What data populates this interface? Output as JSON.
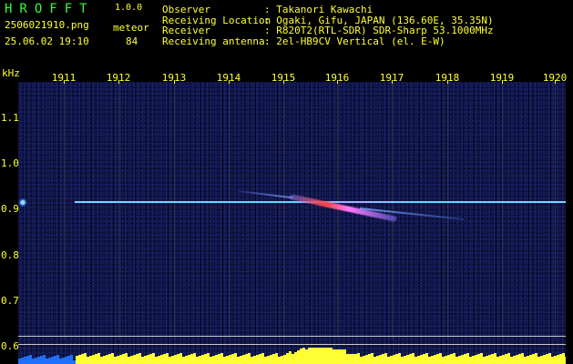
{
  "header": {
    "app_title": "HROFFT",
    "app_version": "1.0.0",
    "file_name": "2506021910.png",
    "mode": "meteor",
    "timestamp": "25.06.02 19:10",
    "count": "84",
    "info_labels": "Observer\nReceiving Location\nReceiver\nReceiving antenna",
    "info_values": ": Takanori Kawachi\n: Ogaki, Gifu, JAPAN (136.60E, 35.35N)\n: R820T2(RTL-SDR) SDR-Sharp 53.1000MHz\n: 2el-HB9CV Vertical (el. E-W)"
  },
  "plot": {
    "unit": "kHz",
    "minutes": [
      "1911",
      "1912",
      "1913",
      "1914",
      "1915",
      "1916",
      "1917",
      "1918",
      "1919",
      "1920"
    ],
    "freq_labels": [
      "1.1",
      "1.0",
      "0.9",
      "0.8",
      "0.7",
      "0.6"
    ],
    "colors": {
      "labels_yellow": "#ffff33",
      "title_green": "#33ff33",
      "background": "#000000",
      "waterfall_bg": "#07071e",
      "carrier": "#4de0ff",
      "meteor_core": "#ff4444",
      "power_blue": "#1f6fff",
      "power_yellow": "#ffff33"
    }
  }
}
